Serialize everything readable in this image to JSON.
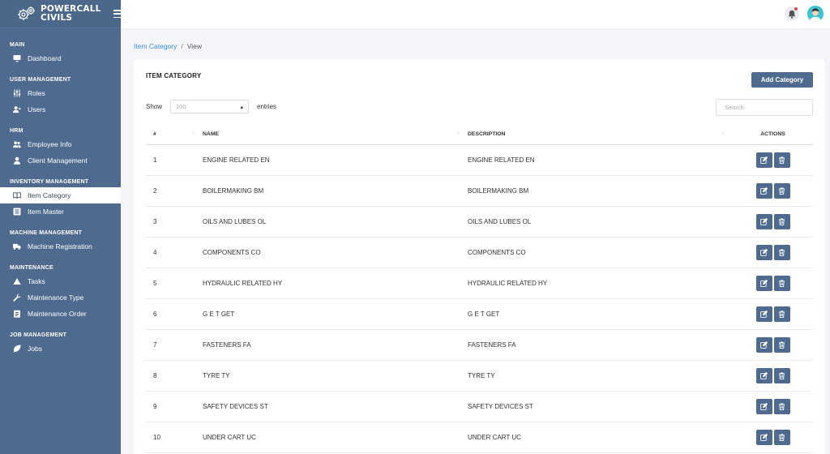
{
  "brand": {
    "line1": "POWERCALL",
    "line2": "CIVILS"
  },
  "sidebar": {
    "sections": {
      "main": "MAIN",
      "user_management": "USER MANAGEMENT",
      "hrm": "HRM",
      "inventory_management": "INVENTORY MANAGEMENT",
      "machine_management": "MACHINE MANAGEMENT",
      "maintenance": "MAINTENANCE",
      "job_management": "JOB MANAGEMENT"
    },
    "items": {
      "dashboard": "Dashboard",
      "roles": "Roles",
      "users": "Users",
      "employee_info": "Employee Info",
      "client_management": "Client Management",
      "item_category": "Item Category",
      "item_master": "Item Master",
      "machine_registration": "Machine Registration",
      "tasks": "Tasks",
      "maintenance_type": "Maintenance Type",
      "maintenance_order": "Maintenance Order",
      "jobs": "Jobs"
    },
    "active": "item_category"
  },
  "breadcrumb": {
    "link": "Item Category",
    "separator": "/",
    "current": "View"
  },
  "card": {
    "title": "ITEM CATEGORY",
    "add_button": "Add Category",
    "show_label": "Show",
    "entries_label": "entries",
    "page_size": "100",
    "search_placeholder": "Search"
  },
  "table": {
    "headers": {
      "num": "#",
      "name": "NAME",
      "description": "DESCRIPTION",
      "actions": "ACTIONS"
    },
    "rows": [
      {
        "num": "1",
        "name": "ENGINE RELATED EN",
        "description": "ENGINE RELATED EN"
      },
      {
        "num": "2",
        "name": "BOILERMAKING BM",
        "description": "BOILERMAKING BM"
      },
      {
        "num": "3",
        "name": "OILS AND LUBES OL",
        "description": "OILS AND LUBES OL"
      },
      {
        "num": "4",
        "name": "COMPONENTS CO",
        "description": "COMPONENTS CO"
      },
      {
        "num": "5",
        "name": "HYDRAULIC RELATED HY",
        "description": "HYDRAULIC RELATED HY"
      },
      {
        "num": "6",
        "name": "G E T GET",
        "description": "G E T GET"
      },
      {
        "num": "7",
        "name": "FASTENERS FA",
        "description": "FASTENERS FA"
      },
      {
        "num": "8",
        "name": "TYRE TY",
        "description": "TYRE TY"
      },
      {
        "num": "9",
        "name": "SAFETY DEVICES ST",
        "description": "SAFETY DEVICES ST"
      },
      {
        "num": "10",
        "name": "UNDER CART UC",
        "description": "UNDER CART UC"
      }
    ]
  },
  "icons": {
    "brand": "gears-icon",
    "menu": "hamburger-icon",
    "notification": "bell-icon",
    "edit": "edit-icon",
    "delete": "trash-icon"
  },
  "colors": {
    "sidebar": "#4e6a8e",
    "accent": "#4e6a8e",
    "link": "#3c8dde"
  }
}
